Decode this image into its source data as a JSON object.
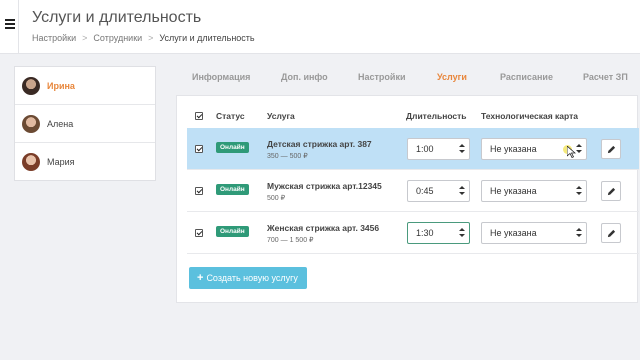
{
  "header": {
    "title": "Услуги и длительность",
    "breadcrumb": [
      "Настройки",
      "Сотрудники",
      "Услуги и длительность"
    ],
    "separator": ">"
  },
  "staff": [
    {
      "name": "Ирина",
      "active": true
    },
    {
      "name": "Алена",
      "active": false
    },
    {
      "name": "Мария",
      "active": false
    }
  ],
  "tabs": [
    "Информация",
    "Доп. инфо",
    "Настройки",
    "Услуги",
    "Расписание",
    "Расчет ЗП"
  ],
  "active_tab": "Услуги",
  "table": {
    "headers": {
      "status": "Статус",
      "service": "Услуга",
      "duration": "Длительность",
      "tech_card": "Технологическая карта"
    },
    "rows": [
      {
        "checked": true,
        "status": "Онлайн",
        "name": "Детская стрижка арт. 387",
        "price": "350 — 500 ₽",
        "duration": "1:00",
        "tech_card": "Не указана",
        "highlighted": true
      },
      {
        "checked": true,
        "status": "Онлайн",
        "name": "Мужская стрижка арт.12345",
        "price": "500 ₽",
        "duration": "0:45",
        "tech_card": "Не указана",
        "highlighted": false
      },
      {
        "checked": true,
        "status": "Онлайн",
        "name": "Женская стрижка арт. 3456",
        "price": "700 — 1 500 ₽",
        "duration": "1:30",
        "tech_card": "Не указана",
        "highlighted": false
      }
    ]
  },
  "create_button": {
    "icon": "plus-icon",
    "label": "Создать новую услугу"
  },
  "colors": {
    "accent": "#e8863b",
    "status_badge": "#2f9a78",
    "create_button": "#5bc0de",
    "row_highlight": "#bfe0f6"
  }
}
